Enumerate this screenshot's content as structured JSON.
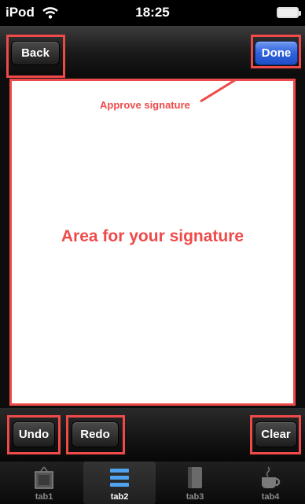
{
  "status_bar": {
    "carrier": "iPod",
    "time": "18:25",
    "wifi_icon": "wifi-icon",
    "battery_icon": "battery-icon"
  },
  "nav_bar": {
    "back_label": "Back",
    "done_label": "Done"
  },
  "signature_area": {
    "caption": "Area for your signature",
    "approve_annotation": "Approve signature"
  },
  "toolbar": {
    "undo_label": "Undo",
    "redo_label": "Redo",
    "clear_label": "Clear"
  },
  "tabs": [
    {
      "label": "tab1",
      "icon": "tv-icon"
    },
    {
      "label": "tab2",
      "icon": "list-icon"
    },
    {
      "label": "tab3",
      "icon": "book-icon"
    },
    {
      "label": "tab4",
      "icon": "coffee-icon"
    }
  ],
  "colors": {
    "annotation": "#ef4a4a",
    "done_button": "#2f62dc",
    "background": "#0d0d0d"
  }
}
